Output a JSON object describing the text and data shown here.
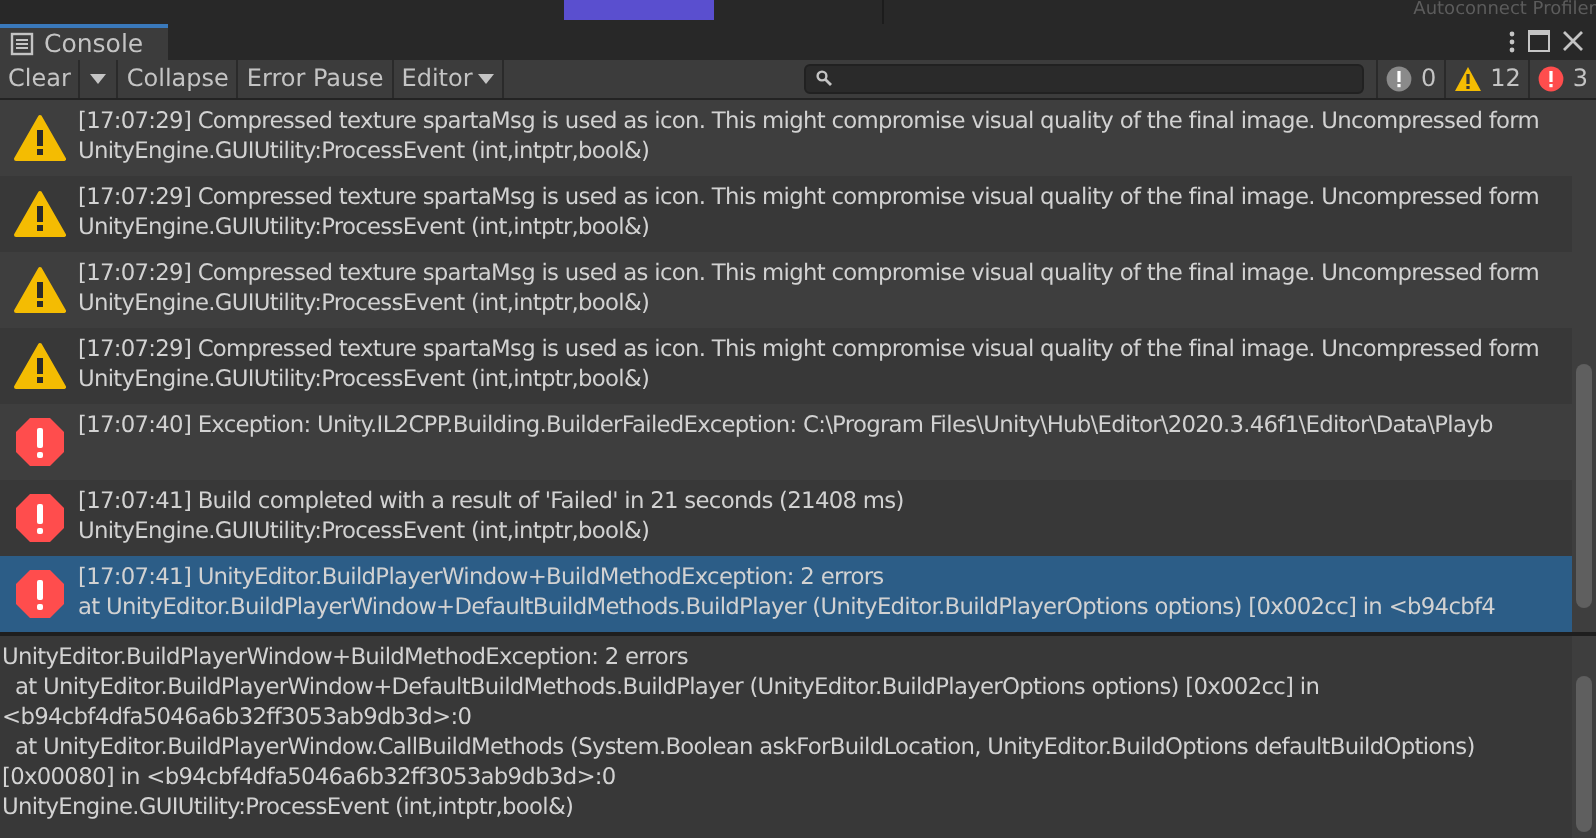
{
  "top_strip": {
    "label": "Autoconnect Profiler"
  },
  "tab": {
    "title": "Console",
    "selected": true
  },
  "toolbar": {
    "buttons": [
      {
        "label": "Clear",
        "kind": "split"
      },
      {
        "label": "Collapse",
        "kind": "toggle",
        "on": false
      },
      {
        "label": "Error Pause",
        "kind": "toggle",
        "on": false
      },
      {
        "label": "Editor",
        "kind": "dropdown"
      }
    ],
    "counters": [
      {
        "kind": "info",
        "count": "0"
      },
      {
        "kind": "warning",
        "count": "12"
      },
      {
        "kind": "error",
        "count": "3"
      }
    ]
  },
  "entries": [
    {
      "kind": "warning",
      "selected": false,
      "lines": [
        "[17:07:29] Compressed texture spartaMsg is used as icon. This might compromise visual quality of the final image. Uncompressed form",
        "UnityEngine.GUIUtility:ProcessEvent (int,intptr,bool&)"
      ]
    },
    {
      "kind": "warning",
      "selected": false,
      "lines": [
        "[17:07:29] Compressed texture spartaMsg is used as icon. This might compromise visual quality of the final image. Uncompressed form",
        "UnityEngine.GUIUtility:ProcessEvent (int,intptr,bool&)"
      ]
    },
    {
      "kind": "warning",
      "selected": false,
      "lines": [
        "[17:07:29] Compressed texture spartaMsg is used as icon. This might compromise visual quality of the final image. Uncompressed form",
        "UnityEngine.GUIUtility:ProcessEvent (int,intptr,bool&)"
      ]
    },
    {
      "kind": "warning",
      "selected": false,
      "lines": [
        "[17:07:29] Compressed texture spartaMsg is used as icon. This might compromise visual quality of the final image. Uncompressed form",
        "UnityEngine.GUIUtility:ProcessEvent (int,intptr,bool&)"
      ]
    },
    {
      "kind": "error",
      "selected": false,
      "lines": [
        "[17:07:40] Exception: Unity.IL2CPP.Building.BuilderFailedException: C:\\Program Files\\Unity\\Hub\\Editor\\2020.3.46f1\\Editor\\Data\\Playb"
      ]
    },
    {
      "kind": "error",
      "selected": false,
      "lines": [
        "[17:07:41] Build completed with a result of 'Failed' in 21 seconds (21408 ms)",
        "UnityEngine.GUIUtility:ProcessEvent (int,intptr,bool&)"
      ]
    },
    {
      "kind": "error",
      "selected": true,
      "lines": [
        "[17:07:41] UnityEditor.BuildPlayerWindow+BuildMethodException: 2 errors",
        " at UnityEditor.BuildPlayerWindow+DefaultBuildMethods.BuildPlayer (UnityEditor.BuildPlayerOptions options) [0x002cc] in <b94cbf4"
      ]
    }
  ],
  "detail": {
    "lines": [
      "UnityEditor.BuildPlayerWindow+BuildMethodException: 2 errors",
      "  at UnityEditor.BuildPlayerWindow+DefaultBuildMethods.BuildPlayer (UnityEditor.BuildPlayerOptions options) [0x002cc] in",
      "<b94cbf4dfa5046a6b32ff3053ab9db3d>:0",
      "  at UnityEditor.BuildPlayerWindow.CallBuildMethods (System.Boolean askForBuildLocation, UnityEditor.BuildOptions defaultBuildOptions)",
      "[0x00080] in <b94cbf4dfa5046a6b32ff3053ab9db3d>:0",
      "UnityEngine.GUIUtility:ProcessEvent (int,intptr,bool&)"
    ]
  }
}
